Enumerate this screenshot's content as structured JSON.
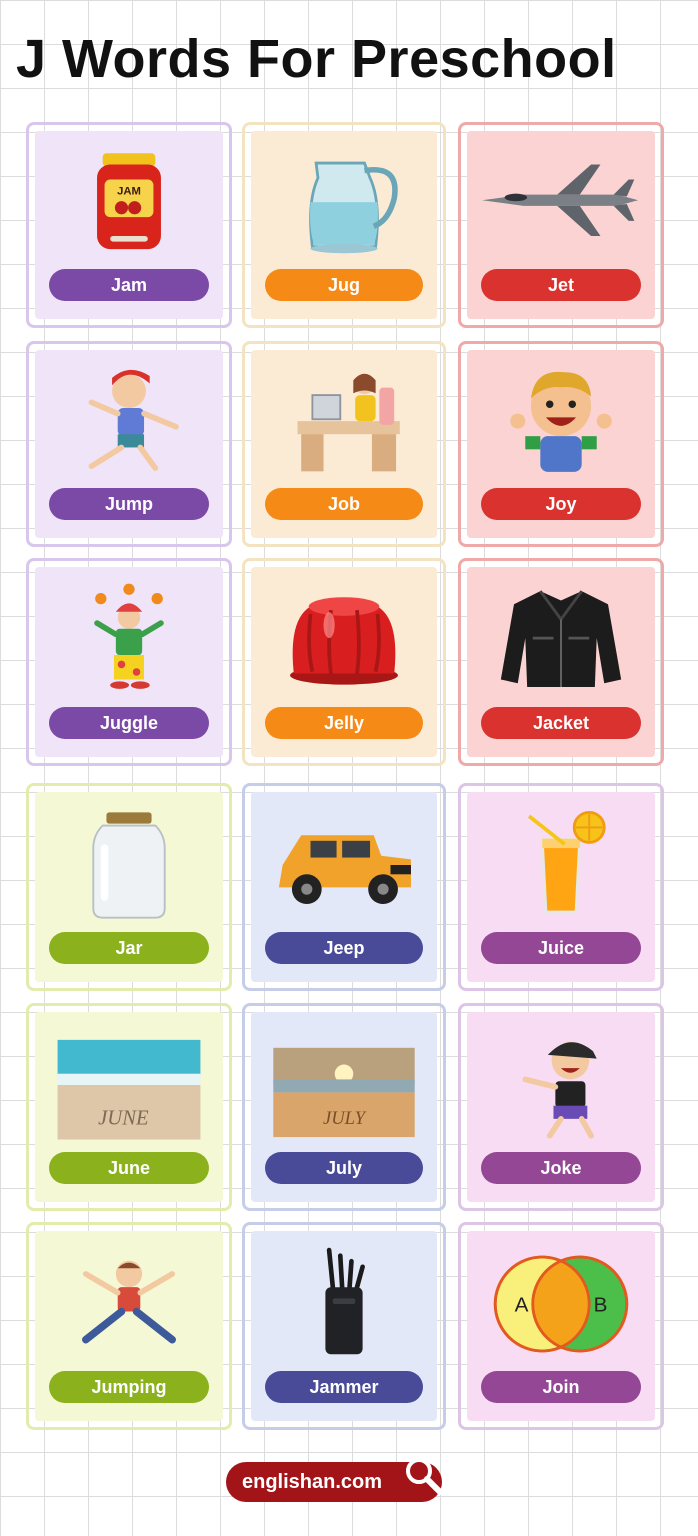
{
  "title": "J Words For Preschool",
  "colors": {
    "purple": {
      "border": "#d8c6ec",
      "bg": "#efe4f8",
      "pill": "#7a4aa6"
    },
    "orange": {
      "border": "#f4e3c0",
      "bg": "#fbebd4",
      "pill": "#f58a16"
    },
    "red": {
      "border": "#f0a9a9",
      "bg": "#fbd3d3",
      "pill": "#d9322f"
    },
    "green": {
      "border": "#e3ecaa",
      "bg": "#f4f8d4",
      "pill": "#8bb21c"
    },
    "blue": {
      "border": "#c5cde9",
      "bg": "#e3e8f8",
      "pill": "#4a4b98"
    },
    "pink": {
      "border": "#dcc5e6",
      "bg": "#f7dcf3",
      "pill": "#944794"
    }
  },
  "cards": [
    {
      "label": "Jam",
      "theme": "purple",
      "icon": "jam-jar-icon",
      "pic_text": "JAM"
    },
    {
      "label": "Jug",
      "theme": "orange",
      "icon": "water-jug-icon"
    },
    {
      "label": "Jet",
      "theme": "red",
      "icon": "fighter-jet-icon"
    },
    {
      "label": "Jump",
      "theme": "purple",
      "icon": "jumping-boy-icon"
    },
    {
      "label": "Job",
      "theme": "orange",
      "icon": "office-desk-icon"
    },
    {
      "label": "Joy",
      "theme": "red",
      "icon": "happy-boy-icon"
    },
    {
      "label": "Juggle",
      "theme": "purple",
      "icon": "juggling-clown-icon"
    },
    {
      "label": "Jelly",
      "theme": "orange",
      "icon": "red-jelly-icon"
    },
    {
      "label": "Jacket",
      "theme": "red",
      "icon": "leather-jacket-icon"
    },
    {
      "label": "Jar",
      "theme": "green",
      "icon": "glass-jar-icon"
    },
    {
      "label": "Jeep",
      "theme": "blue",
      "icon": "jeep-icon"
    },
    {
      "label": "Juice",
      "theme": "pink",
      "icon": "orange-juice-icon"
    },
    {
      "label": "June",
      "theme": "green",
      "icon": "beach-june-icon",
      "pic_text": "JUNE"
    },
    {
      "label": "July",
      "theme": "blue",
      "icon": "sunset-beach-july-icon",
      "pic_text": "JULY"
    },
    {
      "label": "Joke",
      "theme": "pink",
      "icon": "laughing-kid-icon"
    },
    {
      "label": "Jumping",
      "theme": "green",
      "icon": "jumping-child-icon"
    },
    {
      "label": "Jammer",
      "theme": "blue",
      "icon": "signal-jammer-icon"
    },
    {
      "label": "Join",
      "theme": "pink",
      "icon": "venn-diagram-icon",
      "venn": {
        "left": "A",
        "right": "B"
      }
    }
  ],
  "footer": {
    "site": "englishan.com",
    "icon": "search-magnifier-icon"
  }
}
